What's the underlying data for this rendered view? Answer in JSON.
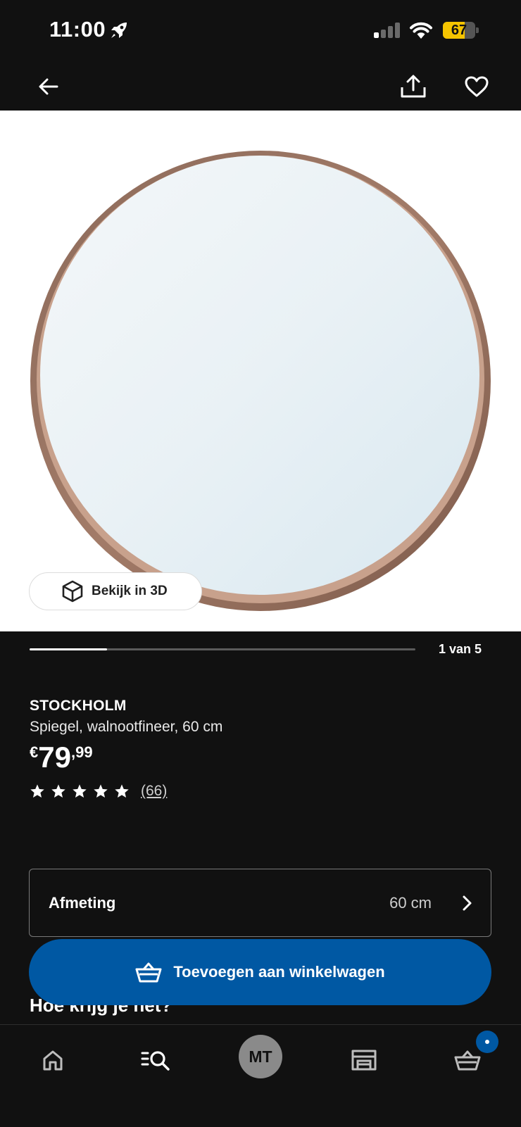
{
  "status_bar": {
    "time": "11:00",
    "battery_percent": "67",
    "battery_level": 0.67,
    "battery_color": "#f5c400",
    "activity_icon": "rocket-icon",
    "signal_bars_active": 1,
    "signal_bars_total": 4
  },
  "nav": {
    "back_icon": "arrow-left-icon",
    "share_icon": "share-icon",
    "favorite_icon": "heart-icon"
  },
  "gallery": {
    "view_3d_label": "Bekijk in 3D",
    "view_3d_icon": "cube-icon",
    "counter": "1 van 5",
    "current_index": 1,
    "total": 5
  },
  "product": {
    "name": "STOCKHOLM",
    "description": "Spiegel, walnootfineer, 60 cm",
    "price_currency": "€",
    "price_integer": "79",
    "price_decimal": ",99",
    "rating_stars": 5,
    "review_count": "(66)"
  },
  "size_selector": {
    "label": "Afmeting",
    "value": "60 cm",
    "chevron_icon": "chevron-right-icon"
  },
  "section": {
    "delivery_heading": "Hoe krijg je het?"
  },
  "cart_button": {
    "label": "Toevoegen aan winkelwagen",
    "icon": "basket-icon",
    "color": "#0058a3"
  },
  "tab_bar": {
    "home_icon": "home-icon",
    "search_icon": "search-list-icon",
    "avatar_initials": "MT",
    "store_icon": "store-icon",
    "cart_icon": "basket-icon",
    "badge_color": "#0058a3"
  }
}
